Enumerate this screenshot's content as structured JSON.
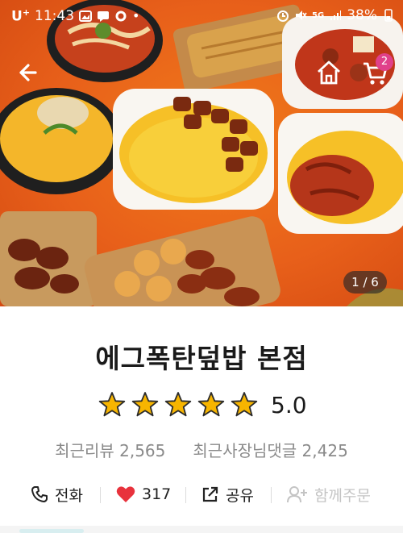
{
  "status_bar": {
    "carrier": "U",
    "carrier_sup": "+",
    "time": "11:43",
    "network": "5G",
    "battery": "38%"
  },
  "hero": {
    "page_indicator": "1 / 6",
    "cart_badge": "2"
  },
  "store": {
    "name": "에그폭탄덮밥 본점",
    "rating": "5.0",
    "stars": 5,
    "star_color": "#f7b500"
  },
  "reviews": {
    "recent_reviews": "최근리뷰 2,565",
    "owner_replies": "최근사장님댓글 2,425"
  },
  "actions": {
    "call": "전화",
    "likes": "317",
    "share": "공유",
    "group_order": "함께주문"
  },
  "colors": {
    "heart": "#e8323c",
    "badge": "#e0408a",
    "disabled": "#c4c4c4"
  }
}
